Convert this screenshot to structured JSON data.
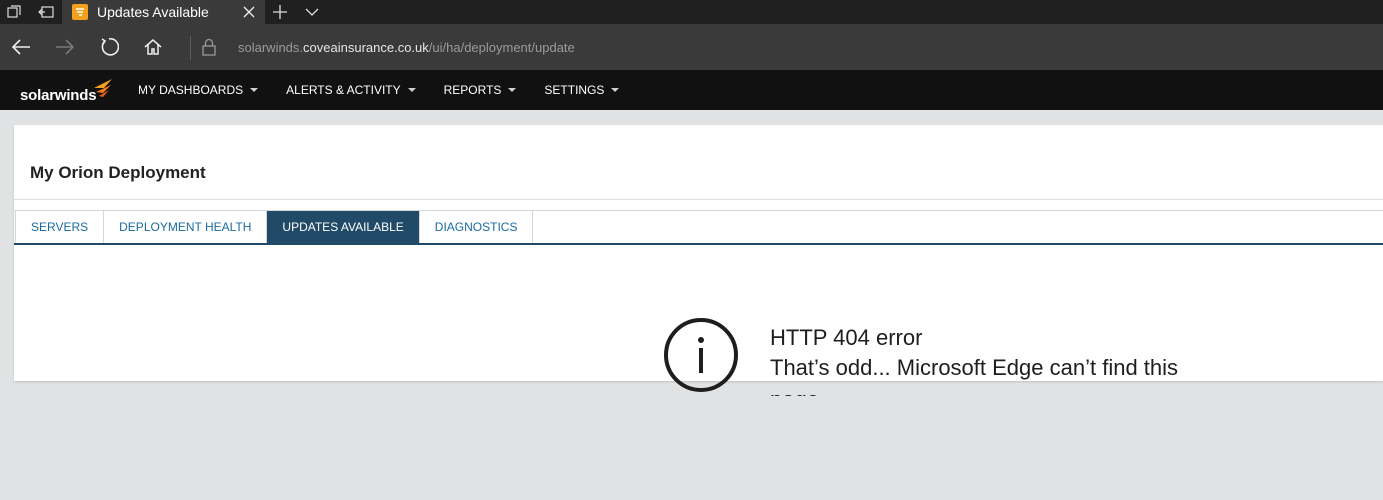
{
  "browser": {
    "tab_title": "Updates Available",
    "url_prefix": "solarwinds.",
    "url_host": "coveainsurance.co.uk",
    "url_path": "/ui/ha/deployment/update"
  },
  "app": {
    "logo_text": "solarwinds",
    "menu": [
      {
        "label": "MY DASHBOARDS"
      },
      {
        "label": "ALERTS & ACTIVITY"
      },
      {
        "label": "REPORTS"
      },
      {
        "label": "SETTINGS"
      }
    ]
  },
  "page": {
    "title": "My Orion Deployment",
    "tabs": [
      {
        "label": "SERVERS",
        "active": false
      },
      {
        "label": "DEPLOYMENT HEALTH",
        "active": false
      },
      {
        "label": "UPDATES AVAILABLE",
        "active": true
      },
      {
        "label": "DIAGNOSTICS",
        "active": false
      }
    ]
  },
  "error": {
    "title": "HTTP 404 error",
    "message": "That’s odd... Microsoft Edge can’t find this page"
  },
  "colors": {
    "active_tab": "#204a67",
    "tab_text": "#1b6aa0",
    "brand_orange": "#f4a21b"
  }
}
